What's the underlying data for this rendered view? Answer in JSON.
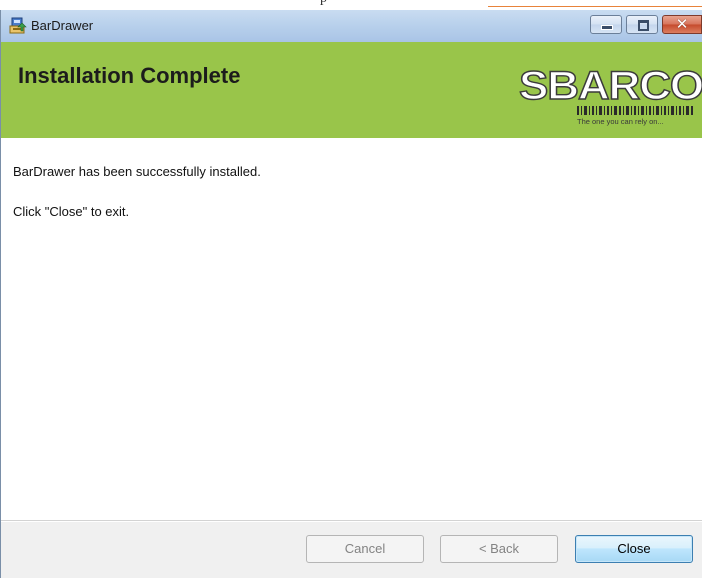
{
  "window": {
    "title": "BarDrawer"
  },
  "banner": {
    "title": "Installation Complete",
    "logo_text": "SBARCO",
    "logo_tagline": "The one you can rely on...",
    "background_color": "#99c54a"
  },
  "content": {
    "message": "BarDrawer has been successfully installed.",
    "instruction": "Click \"Close\" to exit."
  },
  "buttons": {
    "cancel_label": "Cancel",
    "back_label": "< Back",
    "close_label": "Close"
  },
  "top_strip": {
    "fragment": "p"
  },
  "icons": [
    "installer-icon",
    "minimize-icon",
    "maximize-icon",
    "close-icon"
  ]
}
